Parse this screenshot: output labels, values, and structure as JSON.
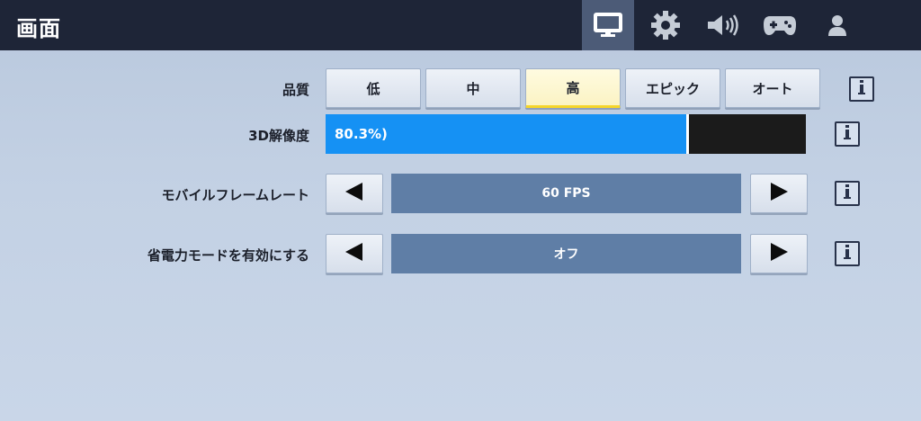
{
  "header": {
    "title": "画面",
    "tabs": [
      {
        "icon": "monitor-icon",
        "active": true
      },
      {
        "icon": "gear-icon",
        "active": false
      },
      {
        "icon": "speaker-icon",
        "active": false
      },
      {
        "icon": "gamepad-icon",
        "active": false
      },
      {
        "icon": "user-icon",
        "active": false
      }
    ]
  },
  "settings": {
    "quality": {
      "label": "品質",
      "options": [
        "低",
        "中",
        "高",
        "エピック",
        "オート"
      ],
      "selected": "高"
    },
    "resolution_3d": {
      "label": "3D解像度",
      "value_text": "80.3%)",
      "fraction": 0.803
    },
    "mobile_frame_rate": {
      "label": "モバイルフレームレート",
      "value": "60 FPS"
    },
    "power_saving": {
      "label": "省電力モードを有効にする",
      "value": "オフ"
    }
  },
  "colors": {
    "header_bg": "#1e2537",
    "active_tab": "#4c5b77",
    "slider_fill": "#1591f4",
    "selected_button_accent": "#f5d52a",
    "value_box": "#5f7ea6"
  }
}
